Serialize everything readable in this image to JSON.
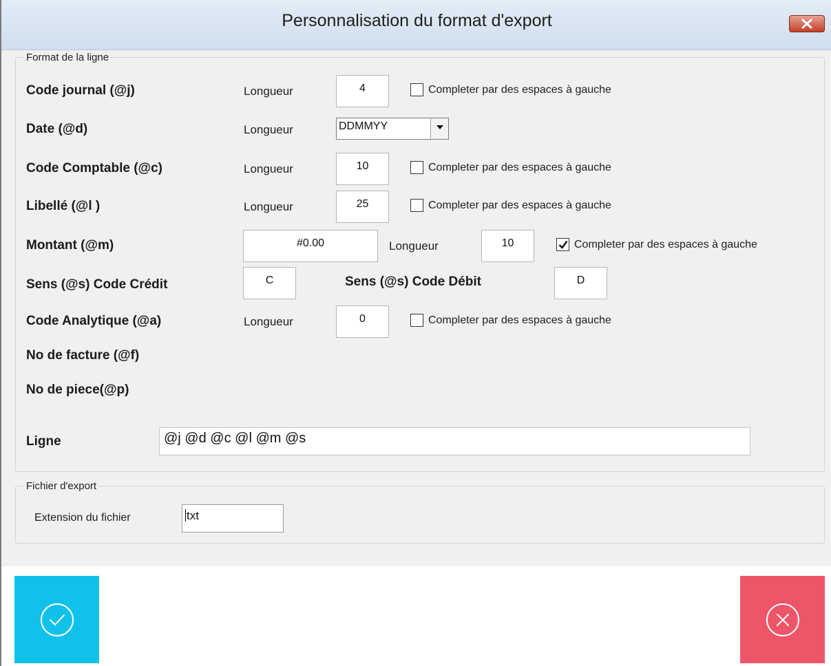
{
  "window": {
    "title": "Personnalisation du format d'export"
  },
  "format_group": {
    "legend": "Format de la ligne",
    "longueur_label": "Longueur",
    "pad_label": "Completer par des espaces à gauche",
    "code_journal": {
      "label": "Code journal (@j)",
      "length": "4",
      "pad_checked": false
    },
    "date": {
      "label": "Date (@d)",
      "format": "DDMMYY"
    },
    "code_comptable": {
      "label": "Code Comptable (@c)",
      "length": "10",
      "pad_checked": false
    },
    "libelle": {
      "label": "Libellé (@l )",
      "length": "25",
      "pad_checked": false
    },
    "montant": {
      "label": "Montant (@m)",
      "format": "#0.00",
      "length": "10",
      "pad_checked": true
    },
    "sens_credit": {
      "label": "Sens (@s)  Code Crédit",
      "value": "C"
    },
    "sens_debit": {
      "label": "Sens (@s)  Code Débit",
      "value": "D"
    },
    "code_analytique": {
      "label": "Code Analytique (@a)",
      "length": "0",
      "pad_checked": false
    },
    "no_facture": {
      "label": "No de facture (@f)"
    },
    "no_piece": {
      "label": "No de piece(@p)"
    },
    "ligne": {
      "label": "Ligne",
      "value": "@j @d @c @l @m @s"
    }
  },
  "export_group": {
    "legend": "Fichier d'export",
    "extension_label": "Extension du fichier",
    "extension_value": "txt"
  },
  "buttons": {
    "ok": {
      "icon": "check-circle-icon",
      "color": "#10c2ea"
    },
    "cancel": {
      "icon": "x-circle-icon",
      "color": "#ef5568"
    }
  },
  "colors": {
    "titlebar": "#d6e3f1",
    "client_bg": "#f0f0f0",
    "close_button": "#c4402a"
  }
}
